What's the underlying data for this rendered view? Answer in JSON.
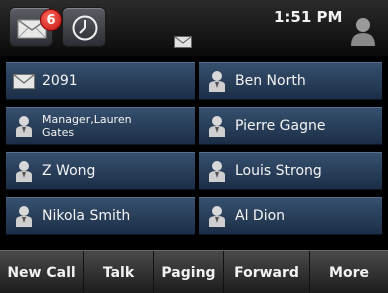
{
  "status_bar": {
    "message_count": "6",
    "time": "1:51 PM",
    "icons": [
      "envelope-icon",
      "clock-icon",
      "envelope-icon",
      "user-icon"
    ]
  },
  "lines": [
    {
      "label": "2091",
      "icon": "envelope-icon"
    },
    {
      "label": "Ben North",
      "icon": "person-icon"
    },
    {
      "label": "Manager,Lauren Gates",
      "icon": "person-icon"
    },
    {
      "label": "Pierre Gagne",
      "icon": "person-icon"
    },
    {
      "label": "Z Wong",
      "icon": "person-icon"
    },
    {
      "label": "Louis Strong",
      "icon": "person-icon"
    },
    {
      "label": "Nikola Smith",
      "icon": "person-icon"
    },
    {
      "label": "Al Dion",
      "icon": "person-icon"
    }
  ],
  "softkeys": [
    "New Call",
    "Talk",
    "Paging",
    "Forward",
    "More"
  ]
}
